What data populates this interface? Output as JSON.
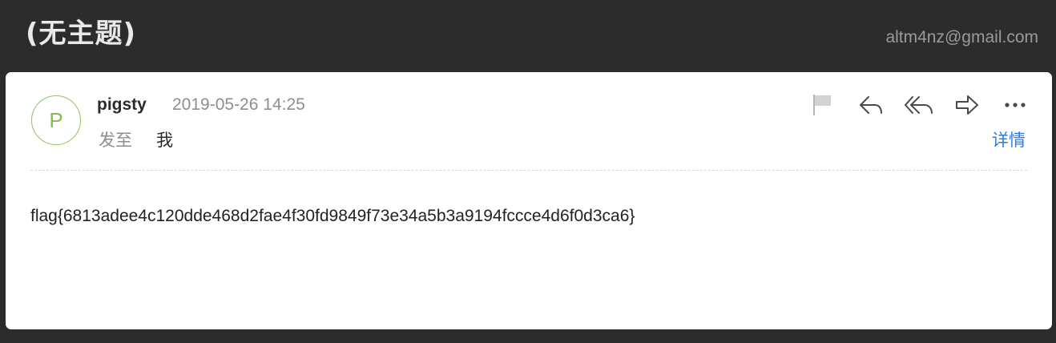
{
  "header": {
    "subject": "(无主题)",
    "account": "altm4nz@gmail.com"
  },
  "message": {
    "avatar_initial": "P",
    "sender": "pigsty",
    "date": "2019-05-26 14:25",
    "to_label": "发至",
    "to_value": "我",
    "details_label": "详情",
    "body": "flag{6813adee4c120dde468d2fae4f30fd9849f73e34a5b3a9194fccce4d6f0d3ca6}"
  },
  "actions": [
    {
      "icon": "flag-icon"
    },
    {
      "icon": "reply-icon"
    },
    {
      "icon": "reply-all-icon"
    },
    {
      "icon": "forward-icon"
    },
    {
      "icon": "more-icon"
    }
  ],
  "colors": {
    "background": "#2c2c2c",
    "card": "#ffffff",
    "accent": "#2f7ae5",
    "avatar": "#86bb4e"
  }
}
